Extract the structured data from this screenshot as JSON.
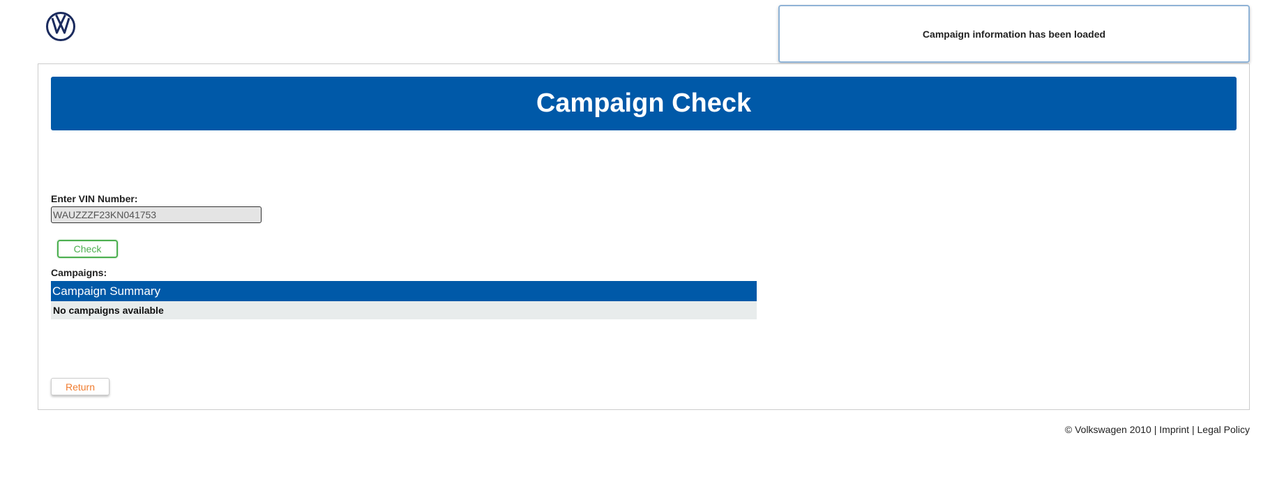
{
  "brand": {
    "logo_icon": "volkswagen-logo-icon",
    "logo_color": "#1b2b5e"
  },
  "toast": {
    "message": "Campaign information has been loaded"
  },
  "header": {
    "title": "Campaign Check",
    "color": "#0059a8"
  },
  "vin": {
    "label": "Enter VIN Number:",
    "value": "WAUZZZF23KN041753"
  },
  "check_button": {
    "label": "Check",
    "color": "#4caf50"
  },
  "campaigns": {
    "label": "Campaigns:",
    "table_header": "Campaign Summary",
    "empty_message": "No campaigns available"
  },
  "return_button": {
    "label": "Return",
    "color": "#f07c2f"
  },
  "footer": {
    "copyright": "© Volkswagen 2010",
    "separator": "|",
    "imprint": "Imprint",
    "legal": "Legal Policy"
  }
}
